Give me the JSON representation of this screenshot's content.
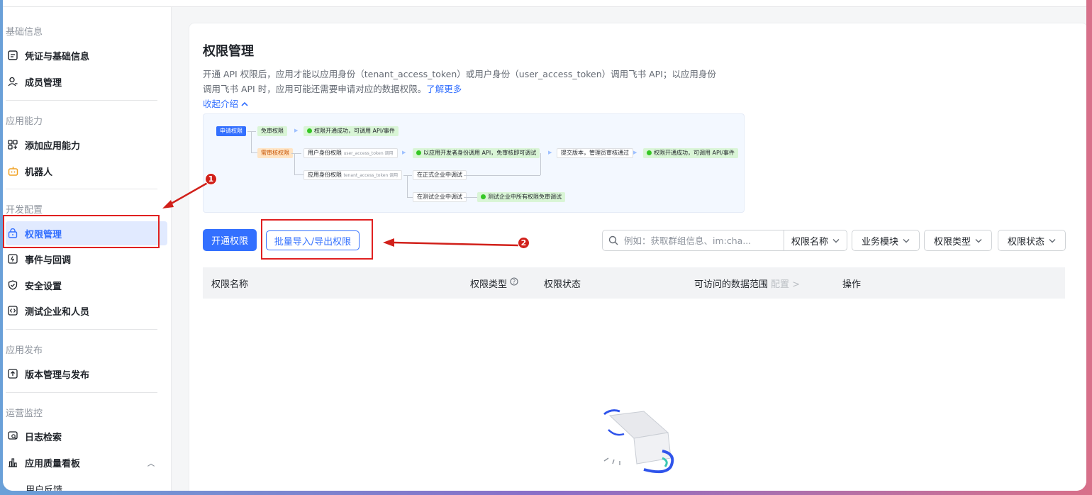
{
  "sidebar": {
    "groups": [
      {
        "label": "基础信息"
      },
      {
        "label": "应用能力"
      },
      {
        "label": "开发配置"
      },
      {
        "label": "应用发布"
      },
      {
        "label": "运营监控"
      }
    ],
    "items": {
      "credentials": {
        "label": "凭证与基础信息",
        "icon": "id-card-icon"
      },
      "members": {
        "label": "成员管理",
        "icon": "user-plus-icon"
      },
      "add_capability": {
        "label": "添加应用能力",
        "icon": "grid-plus-icon"
      },
      "bot": {
        "label": "机器人",
        "icon": "robot-icon"
      },
      "permissions": {
        "label": "权限管理",
        "icon": "lock-icon"
      },
      "events": {
        "label": "事件与回调",
        "icon": "event-icon"
      },
      "security": {
        "label": "安全设置",
        "icon": "shield-icon"
      },
      "test_company": {
        "label": "测试企业和人员",
        "icon": "code-icon"
      },
      "version": {
        "label": "版本管理与发布",
        "icon": "upload-icon"
      },
      "logs": {
        "label": "日志检索",
        "icon": "log-search-icon"
      },
      "quality": {
        "label": "应用质量看板",
        "icon": "dashboard-icon"
      },
      "feedback": {
        "label": "用户反馈"
      }
    }
  },
  "main": {
    "title": "权限管理",
    "description_line1": "开通 API 权限后，应用才能以应用身份（tenant_access_token）或用户身份（user_access_token）调用飞书 API；以应用身份",
    "description_line2": "调用飞书 API 时，应用可能还需要申请对应的数据权限。",
    "learn_more": "了解更多",
    "collapse_label": "收起介绍"
  },
  "flow": {
    "apply": "申请权限",
    "free": "免审权限",
    "free_result": "权限开通成功，可调用 API/事件",
    "review": "需审核权限",
    "user_perm": "用户身份权限",
    "user_token": "user_access_token 调用",
    "dev_call": "以应用开发者身份调用 API，免审核即可调试",
    "submit": "提交版本，管理员审核通过",
    "review_result": "权限开通成功，可调用 API/事件",
    "app_perm": "应用身份权限",
    "tenant_token": "tenant_access_token 调用",
    "formal_debug": "在正式企业中调试",
    "test_debug": "在测试企业中调试",
    "test_result": "测试企业中所有权限免审调试"
  },
  "toolbar": {
    "open_button": "开通权限",
    "batch_button": "批量导入/导出权限",
    "search_placeholder": "例如：获取群组信息、im:cha...",
    "search_field": "权限名称",
    "filters": [
      "业务模块",
      "权限类型",
      "权限状态"
    ]
  },
  "table": {
    "columns": {
      "name": "权限名称",
      "type": "权限类型",
      "status": "权限状态",
      "scope": "可访问的数据范围",
      "scope_config": "配置 >",
      "action": "操作"
    }
  },
  "annotations": {
    "first": "1",
    "second": "2"
  },
  "colors": {
    "accent": "#3370ff",
    "annotation": "#e02020"
  }
}
